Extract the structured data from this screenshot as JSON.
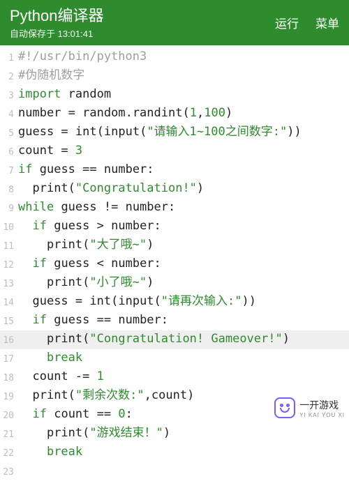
{
  "header": {
    "title": "Python编译器",
    "autosave": "自动保存于 13:01:41",
    "run_label": "运行",
    "menu_label": "菜单"
  },
  "highlighted_line": 16,
  "code_lines": [
    [
      {
        "t": "comment",
        "v": "#!/usr/bin/python3"
      }
    ],
    [
      {
        "t": "comment",
        "v": "#伪随机数字"
      }
    ],
    [
      {
        "t": "kw",
        "v": "import"
      },
      {
        "t": "op",
        "v": " "
      },
      {
        "t": "ident",
        "v": "random"
      }
    ],
    [
      {
        "t": "ident",
        "v": "number"
      },
      {
        "t": "op",
        "v": " = "
      },
      {
        "t": "ident",
        "v": "random"
      },
      {
        "t": "punct",
        "v": "."
      },
      {
        "t": "ident",
        "v": "randint"
      },
      {
        "t": "punct",
        "v": "("
      },
      {
        "t": "num",
        "v": "1"
      },
      {
        "t": "punct",
        "v": ","
      },
      {
        "t": "num",
        "v": "100"
      },
      {
        "t": "punct",
        "v": ")"
      }
    ],
    [
      {
        "t": "ident",
        "v": "guess"
      },
      {
        "t": "op",
        "v": " = "
      },
      {
        "t": "builtin",
        "v": "int"
      },
      {
        "t": "punct",
        "v": "("
      },
      {
        "t": "builtin",
        "v": "input"
      },
      {
        "t": "punct",
        "v": "("
      },
      {
        "t": "str",
        "v": "\"请输入1~100之间数字:\""
      },
      {
        "t": "punct",
        "v": ")"
      },
      {
        "t": "punct",
        "v": ")"
      }
    ],
    [
      {
        "t": "ident",
        "v": "count"
      },
      {
        "t": "op",
        "v": " = "
      },
      {
        "t": "num",
        "v": "3"
      }
    ],
    [
      {
        "t": "kw",
        "v": "if"
      },
      {
        "t": "op",
        "v": " "
      },
      {
        "t": "ident",
        "v": "guess"
      },
      {
        "t": "op",
        "v": " == "
      },
      {
        "t": "ident",
        "v": "number"
      },
      {
        "t": "punct",
        "v": ":"
      }
    ],
    [
      {
        "t": "op",
        "v": "  "
      },
      {
        "t": "builtin",
        "v": "print"
      },
      {
        "t": "punct",
        "v": "("
      },
      {
        "t": "str",
        "v": "\"Congratulation!\""
      },
      {
        "t": "punct",
        "v": ")"
      }
    ],
    [
      {
        "t": "kw",
        "v": "while"
      },
      {
        "t": "op",
        "v": " "
      },
      {
        "t": "ident",
        "v": "guess"
      },
      {
        "t": "op",
        "v": " != "
      },
      {
        "t": "ident",
        "v": "number"
      },
      {
        "t": "punct",
        "v": ":"
      }
    ],
    [
      {
        "t": "op",
        "v": "  "
      },
      {
        "t": "kw",
        "v": "if"
      },
      {
        "t": "op",
        "v": " "
      },
      {
        "t": "ident",
        "v": "guess"
      },
      {
        "t": "op",
        "v": " > "
      },
      {
        "t": "ident",
        "v": "number"
      },
      {
        "t": "punct",
        "v": ":"
      }
    ],
    [
      {
        "t": "op",
        "v": "    "
      },
      {
        "t": "builtin",
        "v": "print"
      },
      {
        "t": "punct",
        "v": "("
      },
      {
        "t": "str",
        "v": "\"大了哦~\""
      },
      {
        "t": "punct",
        "v": ")"
      }
    ],
    [
      {
        "t": "op",
        "v": "  "
      },
      {
        "t": "kw",
        "v": "if"
      },
      {
        "t": "op",
        "v": " "
      },
      {
        "t": "ident",
        "v": "guess"
      },
      {
        "t": "op",
        "v": " < "
      },
      {
        "t": "ident",
        "v": "number"
      },
      {
        "t": "punct",
        "v": ":"
      }
    ],
    [
      {
        "t": "op",
        "v": "    "
      },
      {
        "t": "builtin",
        "v": "print"
      },
      {
        "t": "punct",
        "v": "("
      },
      {
        "t": "str",
        "v": "\"小了哦~\""
      },
      {
        "t": "punct",
        "v": ")"
      }
    ],
    [
      {
        "t": "op",
        "v": "  "
      },
      {
        "t": "ident",
        "v": "guess"
      },
      {
        "t": "op",
        "v": " = "
      },
      {
        "t": "builtin",
        "v": "int"
      },
      {
        "t": "punct",
        "v": "("
      },
      {
        "t": "builtin",
        "v": "input"
      },
      {
        "t": "punct",
        "v": "("
      },
      {
        "t": "str",
        "v": "\"请再次输入:\""
      },
      {
        "t": "punct",
        "v": ")"
      },
      {
        "t": "punct",
        "v": ")"
      }
    ],
    [
      {
        "t": "op",
        "v": "  "
      },
      {
        "t": "kw",
        "v": "if"
      },
      {
        "t": "op",
        "v": " "
      },
      {
        "t": "ident",
        "v": "guess"
      },
      {
        "t": "op",
        "v": " == "
      },
      {
        "t": "ident",
        "v": "number"
      },
      {
        "t": "punct",
        "v": ":"
      }
    ],
    [
      {
        "t": "op",
        "v": "    "
      },
      {
        "t": "builtin",
        "v": "print"
      },
      {
        "t": "punct",
        "v": "("
      },
      {
        "t": "str",
        "v": "\"Congratulation! Gameover!\""
      },
      {
        "t": "punct",
        "v": ")"
      }
    ],
    [
      {
        "t": "op",
        "v": "    "
      },
      {
        "t": "kw",
        "v": "break"
      }
    ],
    [
      {
        "t": "op",
        "v": "  "
      },
      {
        "t": "ident",
        "v": "count"
      },
      {
        "t": "op",
        "v": " -= "
      },
      {
        "t": "num",
        "v": "1"
      }
    ],
    [
      {
        "t": "op",
        "v": "  "
      },
      {
        "t": "builtin",
        "v": "print"
      },
      {
        "t": "punct",
        "v": "("
      },
      {
        "t": "str",
        "v": "\"剩余次数:\""
      },
      {
        "t": "punct",
        "v": ","
      },
      {
        "t": "ident",
        "v": "count"
      },
      {
        "t": "punct",
        "v": ")"
      }
    ],
    [
      {
        "t": "op",
        "v": "  "
      },
      {
        "t": "kw",
        "v": "if"
      },
      {
        "t": "op",
        "v": " "
      },
      {
        "t": "ident",
        "v": "count"
      },
      {
        "t": "op",
        "v": " == "
      },
      {
        "t": "num",
        "v": "0"
      },
      {
        "t": "punct",
        "v": ":"
      }
    ],
    [
      {
        "t": "op",
        "v": "    "
      },
      {
        "t": "builtin",
        "v": "print"
      },
      {
        "t": "punct",
        "v": "("
      },
      {
        "t": "str",
        "v": "\"游戏结束！\""
      },
      {
        "t": "punct",
        "v": ")"
      }
    ],
    [
      {
        "t": "op",
        "v": "    "
      },
      {
        "t": "kw",
        "v": "break"
      }
    ],
    []
  ],
  "watermark": {
    "text": "一开游戏",
    "sub": "YI KAI YOU XI"
  }
}
